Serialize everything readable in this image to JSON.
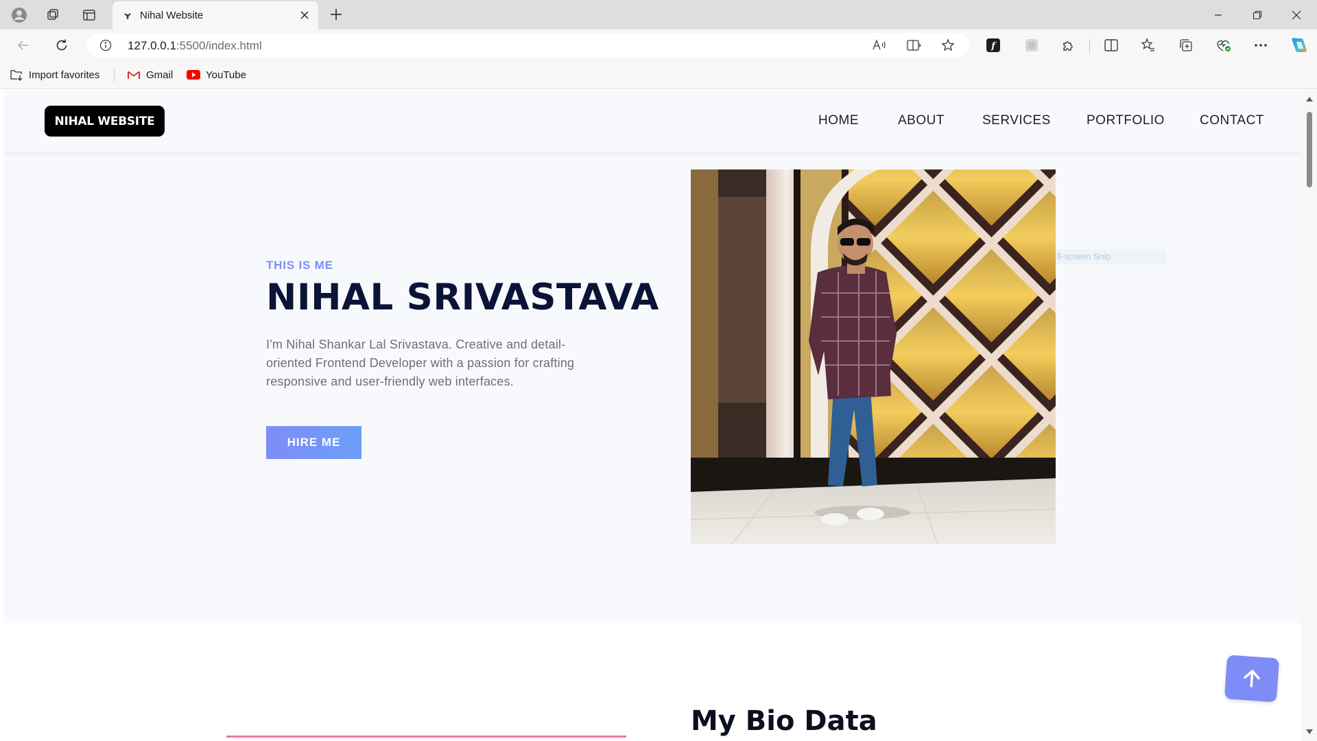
{
  "browser": {
    "tab_title": "Nihal Website",
    "url_host": "127.0.0.1",
    "url_rest": ":5500/index.html",
    "favorites": {
      "import_label": "Import favorites",
      "gmail_label": "Gmail",
      "youtube_label": "YouTube"
    }
  },
  "site": {
    "logo": "NIHAL WEBSITE",
    "nav": {
      "home": "HOME",
      "about": "ABOUT",
      "services": "SERVICES",
      "portfolio": "PORTFOLIO",
      "contact": "CONTACT"
    },
    "hero": {
      "eyebrow": "THIS IS ME",
      "name": "NIHAL SRIVASTAVA",
      "description": "I'm Nihal Shankar Lal Srivastava. Creative and detail-oriented Frontend Developer with a passion for crafting responsive and user-friendly web interfaces.",
      "cta": "HIRE ME"
    },
    "ghost_overlay_text": "ll-screen Snip",
    "bio": {
      "title": "My Bio Data"
    }
  },
  "colors": {
    "accent": "#7d8cf7",
    "heading": "#0b1437",
    "page_bg": "#f8f9fd"
  }
}
